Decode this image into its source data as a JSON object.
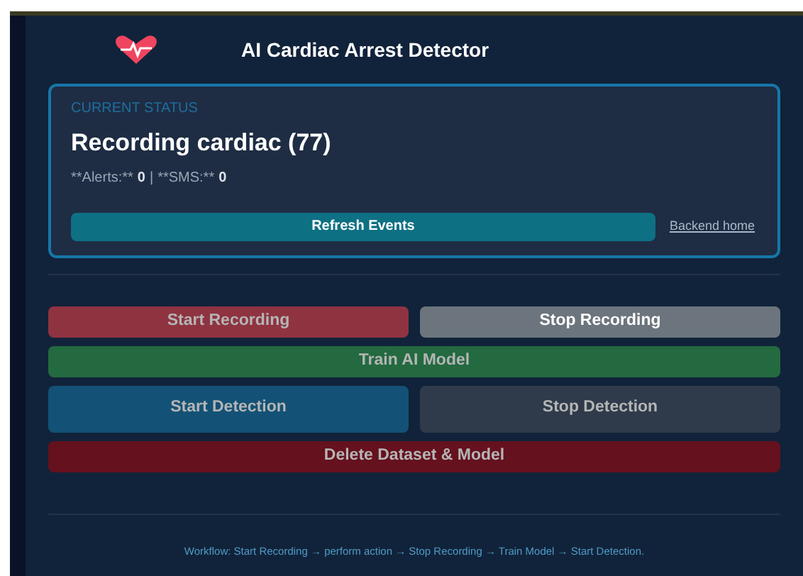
{
  "header": {
    "title": "AI Cardiac Arrest Detector"
  },
  "status_card": {
    "label": "CURRENT STATUS",
    "status": "Recording cardiac (77)",
    "alerts_label": "**Alerts:**",
    "alerts_value": "0",
    "separator": "|",
    "sms_label": "**SMS:**",
    "sms_value": "0",
    "refresh_button": "Refresh Events",
    "backend_link": "Backend home"
  },
  "controls": [
    {
      "label": "Start Recording",
      "kind": "record",
      "disabled": true
    },
    {
      "label": "Stop Recording",
      "kind": "neutral",
      "disabled": false
    },
    {
      "label": "Train AI Model",
      "kind": "train",
      "disabled": true
    },
    {
      "label": "Start Detection",
      "kind": "detect",
      "disabled": true
    },
    {
      "label": "Stop Detection",
      "kind": "dark",
      "disabled": true
    },
    {
      "label": "Delete Dataset & Model",
      "kind": "delete",
      "disabled": true
    }
  ],
  "footer": "Workflow: Start Recording → perform action → Stop Recording → Train Model → Start Detection."
}
